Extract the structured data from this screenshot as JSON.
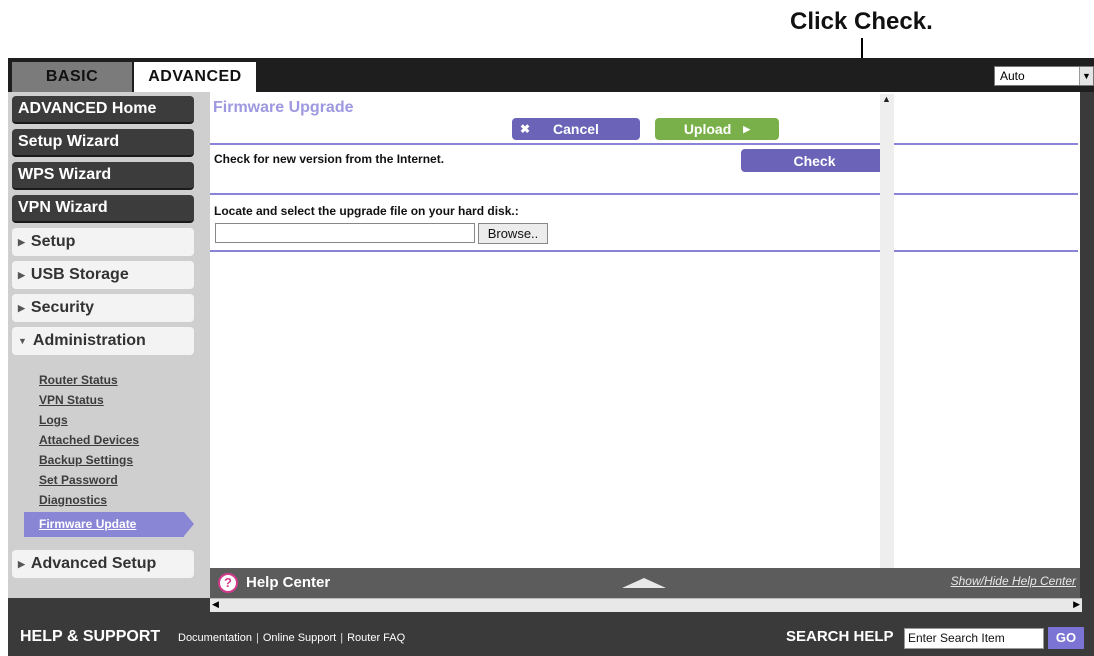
{
  "annotation": {
    "text": "Click Check."
  },
  "tabs": {
    "basic": "BASIC",
    "advanced": "ADVANCED"
  },
  "language": {
    "selected": "Auto"
  },
  "sidebar": {
    "primary": [
      "ADVANCED Home",
      "Setup Wizard",
      "WPS Wizard",
      "VPN Wizard"
    ],
    "sections": [
      "Setup",
      "USB Storage",
      "Security",
      "Administration"
    ],
    "admin_links": [
      "Router Status",
      "VPN Status",
      "Logs",
      "Attached Devices",
      "Backup Settings",
      "Set Password",
      "Diagnostics"
    ],
    "active": "Firmware Update",
    "advanced_setup": "Advanced Setup"
  },
  "main": {
    "title": "Firmware Upgrade",
    "cancel_label": "Cancel",
    "upload_label": "Upload",
    "check_text": "Check for new version from the Internet.",
    "check_label": "Check",
    "locate_text": "Locate and select the upgrade file on your hard disk.:",
    "browse_label": "Browse.."
  },
  "help": {
    "title": "Help Center",
    "toggle_link": "Show/Hide Help Center"
  },
  "footer": {
    "title": "HELP & SUPPORT",
    "links": [
      "Documentation",
      "Online Support",
      "Router FAQ"
    ],
    "search_label": "SEARCH HELP",
    "search_value": "Enter Search Item",
    "go_label": "GO"
  },
  "colors": {
    "accent": "#6a63b8",
    "upload": "#7ab04a",
    "line": "#8a84d8"
  }
}
